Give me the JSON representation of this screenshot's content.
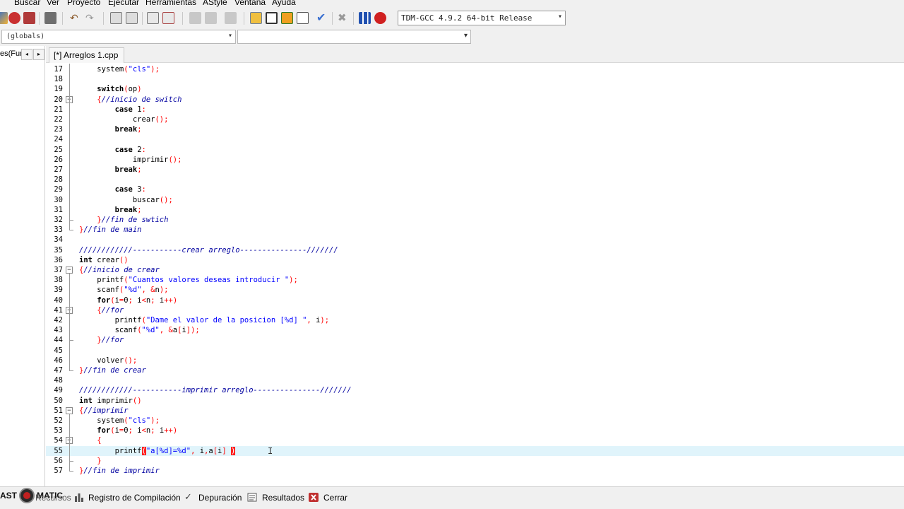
{
  "menu": [
    "Buscar",
    "Ver",
    "Proyecto",
    "Ejecutar",
    "Herramientas",
    "AStyle",
    "Ventana",
    "Ayuda"
  ],
  "toolbar": {
    "compiler": "TDM-GCC 4.9.2 64-bit Release",
    "icons": [
      "compile-run-icon",
      "compile-icon",
      "print-icon",
      "undo-icon",
      "redo-icon",
      "find-icon",
      "replace-icon",
      "indent-icon",
      "unindent-icon",
      "bookmark-icon",
      "grid-icon",
      "window-icon",
      "tile-icon",
      "check-icon",
      "delete-icon",
      "chart-icon",
      "debug-icon"
    ]
  },
  "scope": {
    "globals": "(globals)",
    "function": ""
  },
  "left_panel": {
    "tab": "es(Fun",
    "prev": "◂",
    "next": "▸"
  },
  "editor": {
    "tab_title": "[*] Arreglos 1.cpp",
    "current_line": 55,
    "lines": [
      {
        "n": "17",
        "t": "    system(\"cls\");"
      },
      {
        "n": "18",
        "t": ""
      },
      {
        "n": "19",
        "t": "    switch(op)"
      },
      {
        "n": "20",
        "t": "    {//inicio de switch"
      },
      {
        "n": "21",
        "t": "        case 1:"
      },
      {
        "n": "22",
        "t": "            crear();"
      },
      {
        "n": "23",
        "t": "        break;"
      },
      {
        "n": "24",
        "t": ""
      },
      {
        "n": "25",
        "t": "        case 2:"
      },
      {
        "n": "26",
        "t": "            imprimir();"
      },
      {
        "n": "27",
        "t": "        break;"
      },
      {
        "n": "28",
        "t": ""
      },
      {
        "n": "29",
        "t": "        case 3:"
      },
      {
        "n": "30",
        "t": "            buscar();"
      },
      {
        "n": "31",
        "t": "        break;"
      },
      {
        "n": "32",
        "t": "    }//fin de swtich"
      },
      {
        "n": "33",
        "t": "}//fin de main"
      },
      {
        "n": "34",
        "t": ""
      },
      {
        "n": "35",
        "t": "////////////-----------crear arreglo---------------///////"
      },
      {
        "n": "36",
        "t": "int crear()"
      },
      {
        "n": "37",
        "t": "{//inicio de crear"
      },
      {
        "n": "38",
        "t": "    printf(\"Cuantos valores deseas introducir \");"
      },
      {
        "n": "39",
        "t": "    scanf(\"%d\", &n);"
      },
      {
        "n": "40",
        "t": "    for(i=0; i<n; i++)"
      },
      {
        "n": "41",
        "t": "    {//for"
      },
      {
        "n": "42",
        "t": "        printf(\"Dame el valor de la posicion [%d] \", i);"
      },
      {
        "n": "43",
        "t": "        scanf(\"%d\", &a[i]);"
      },
      {
        "n": "44",
        "t": "    }//for"
      },
      {
        "n": "45",
        "t": ""
      },
      {
        "n": "46",
        "t": "    volver();"
      },
      {
        "n": "47",
        "t": "}//fin de crear"
      },
      {
        "n": "48",
        "t": ""
      },
      {
        "n": "49",
        "t": "////////////-----------imprimir arreglo---------------///////"
      },
      {
        "n": "50",
        "t": "int imprimir()"
      },
      {
        "n": "51",
        "t": "{//imprimir"
      },
      {
        "n": "52",
        "t": "    system(\"cls\");"
      },
      {
        "n": "53",
        "t": "    for(i=0; i<n; i++)"
      },
      {
        "n": "54",
        "t": "    {"
      },
      {
        "n": "55",
        "t": "        printf(\"a[%d]=%d\", i,a[i] )"
      },
      {
        "n": "56",
        "t": "    }"
      },
      {
        "n": "57",
        "t": "}//fin de imprimir"
      }
    ]
  },
  "bottom": {
    "badge": "AST  MATIC",
    "tabs": [
      "Recursos",
      "Registro de Compilación",
      "Depuración",
      "Resultados",
      "Cerrar"
    ]
  },
  "colors": {
    "keyword": "#000000",
    "string": "#0000ff",
    "comment": "#0000a0",
    "symbol": "#ff0000",
    "current_line_bg": "#e0f4fb",
    "bracket_match_bg": "#ff2020"
  }
}
